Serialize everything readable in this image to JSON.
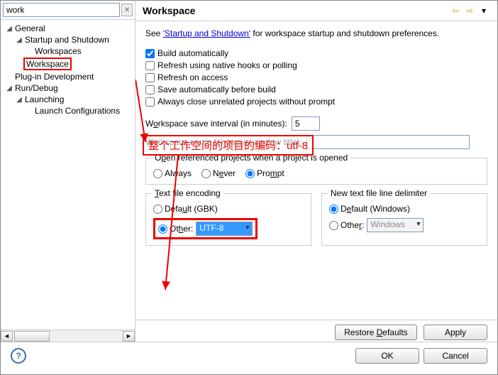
{
  "search_value": "work",
  "tree": {
    "general": "General",
    "startup": "Startup and Shutdown",
    "workspaces": "Workspaces",
    "workspace": "Workspace",
    "plugindev": "Plug-in Development",
    "rundebug": "Run/Debug",
    "launching": "Launching",
    "launchconf": "Launch Configurations"
  },
  "page_title": "Workspace",
  "see_prefix": "See ",
  "see_link": "'Startup and Shutdown'",
  "see_suffix": " for workspace startup and shutdown preferences.",
  "cb": {
    "build_auto": "Build automatically",
    "refresh_native": "Refresh using native hooks or polling",
    "refresh_access": "Refresh on access",
    "save_before_build": "Save automatically before build",
    "close_unrelated": "Always close unrelated projects without prompt"
  },
  "save_interval_label": "Workspace save interval (in minutes):",
  "save_interval_value": "5",
  "ws_name_label": "Workspace name (shown in window title):",
  "ws_name_value": "",
  "annotation": "整个工作空间的项目的编码：utf-8",
  "open_ref": {
    "title": "Open referenced projects when a project is opened",
    "always": "Always",
    "never": "Never",
    "prompt": "Prompt"
  },
  "encoding": {
    "title": "Text file encoding",
    "default_label": "Default (GBK)",
    "other_label": "Other:",
    "other_value": "UTF-8"
  },
  "delimiter": {
    "title": "New text file line delimiter",
    "default_label": "Default (Windows)",
    "other_label": "Other:",
    "other_value": "Windows"
  },
  "buttons": {
    "restore": "Restore Defaults",
    "apply": "Apply",
    "ok": "OK",
    "cancel": "Cancel"
  }
}
